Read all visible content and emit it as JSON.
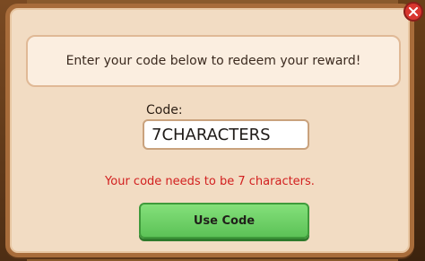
{
  "dialog": {
    "banner_text": "Enter your code below to redeem your reward!",
    "code_label": "Code:",
    "code_value": "7CHARACTERS",
    "error_text": "Your code needs to be 7 characters.",
    "button_label": "Use Code"
  },
  "icons": {
    "close": "close-icon"
  },
  "colors": {
    "error": "#d21f1f",
    "button_green": "#5cc257",
    "dialog_bg": "#f2dcc3",
    "frame": "#a86c3a"
  }
}
